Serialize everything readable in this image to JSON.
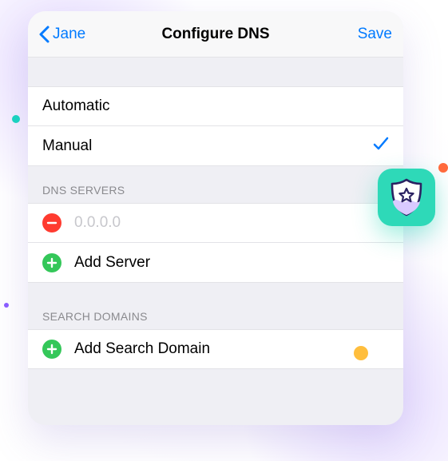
{
  "nav": {
    "back_label": "Jane",
    "title": "Configure DNS",
    "save_label": "Save"
  },
  "mode": {
    "options": [
      "Automatic",
      "Manual"
    ],
    "selected": "Manual"
  },
  "dns_servers": {
    "header": "DNS SERVERS",
    "entries": [
      {
        "value": "",
        "placeholder": "0.0.0.0"
      }
    ],
    "add_label": "Add Server"
  },
  "search_domains": {
    "header": "SEARCH DOMAINS",
    "add_label": "Add Search Domain"
  },
  "colors": {
    "accent": "#007aff",
    "delete": "#ff3b30",
    "add": "#34c759",
    "shield_bg": "#2ed9b8"
  }
}
